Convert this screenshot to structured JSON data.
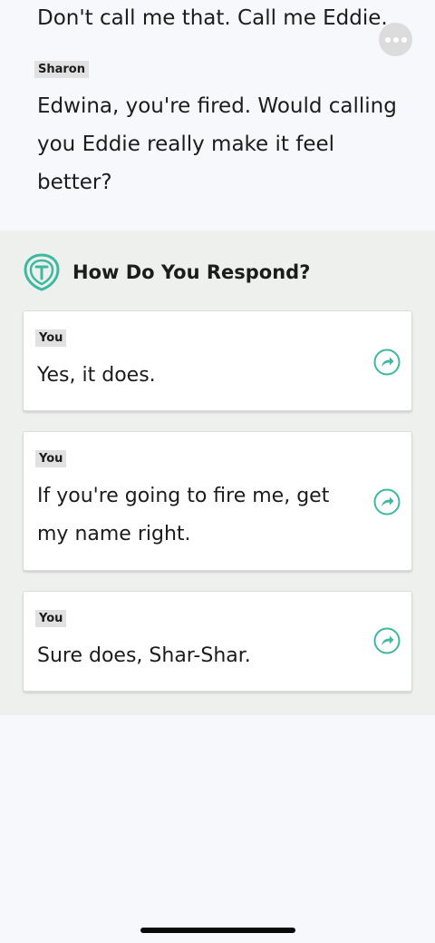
{
  "conversation": {
    "previous_line": "Don't call me that. Call me Eddie.",
    "speaker": "Sharon",
    "line": "Edwina, you're fired. Would calling you Eddie really make it feel better?"
  },
  "more_button": {
    "icon": "more-horizontal-icon"
  },
  "respond": {
    "title": "How Do You Respond?",
    "logo_icon": "app-logo-icon",
    "accent_color": "#3db8a1",
    "choices": [
      {
        "speaker": "You",
        "text": "Yes, it does.",
        "icon": "send-arrow-icon"
      },
      {
        "speaker": "You",
        "text": "If you're going to fire me, get my name right.",
        "icon": "send-arrow-icon"
      },
      {
        "speaker": "You",
        "text": "Sure does, Shar-Shar.",
        "icon": "send-arrow-icon"
      }
    ]
  }
}
